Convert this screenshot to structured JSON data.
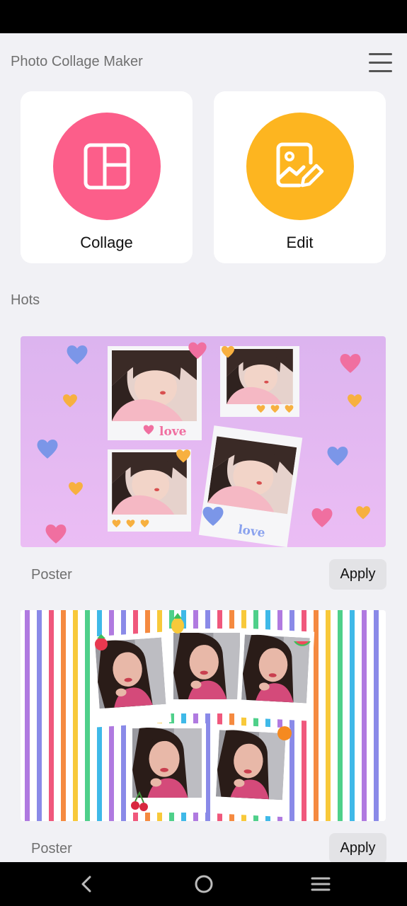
{
  "header": {
    "title": "Photo Collage Maker"
  },
  "features": [
    {
      "label": "Collage",
      "color": "#fc5e8a",
      "icon": "collage-layout-icon"
    },
    {
      "label": "Edit",
      "color": "#fdb520",
      "icon": "photo-edit-icon"
    }
  ],
  "hots": {
    "title": "Hots",
    "templates": [
      {
        "label": "Poster",
        "apply_label": "Apply",
        "sticker_text": [
          "love",
          "love"
        ],
        "theme": "purple-hearts"
      },
      {
        "label": "Poster",
        "apply_label": "Apply",
        "theme": "rainbow-stripes"
      }
    ]
  },
  "navbar": {
    "icons": [
      "back-icon",
      "home-icon",
      "recents-icon"
    ]
  }
}
